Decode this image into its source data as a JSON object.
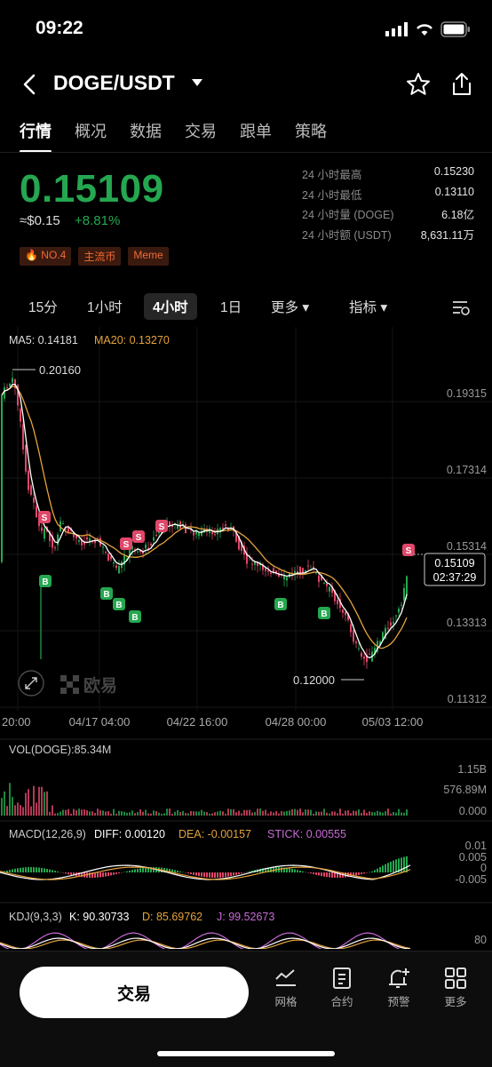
{
  "status": {
    "time": "09:22"
  },
  "header": {
    "pair": "DOGE/USDT"
  },
  "tabs": [
    "行情",
    "概况",
    "数据",
    "交易",
    "跟单",
    "策略"
  ],
  "ticker": {
    "price": "0.15109",
    "usd": "≈$0.15",
    "change": "+8.81%",
    "tags": [
      "NO.4",
      "主流币",
      "Meme"
    ],
    "stats": [
      {
        "label": "24 小时最高",
        "value": "0.15230"
      },
      {
        "label": "24 小时最低",
        "value": "0.13110"
      },
      {
        "label": "24 小时量 (DOGE)",
        "value": "6.18亿"
      },
      {
        "label": "24 小时额 (USDT)",
        "value": "8,631.11万"
      }
    ]
  },
  "intervals": {
    "i15": "15分",
    "i1h": "1小时",
    "i4h": "4小时",
    "i1d": "1日",
    "more": "更多",
    "indicator": "指标"
  },
  "main_chart": {
    "ma5": "MA5: 0.14181",
    "ma20": "MA20: 0.13270",
    "y_ticks": [
      "0.19315",
      "0.17314",
      "0.15314",
      "0.13313",
      "0.11312"
    ],
    "x_ticks": [
      "20:00",
      "04/17 04:00",
      "04/22 16:00",
      "04/28 00:00",
      "05/03 12:00"
    ],
    "high_label": "0.20160",
    "low_label": "0.12000",
    "last_price": "0.15109",
    "countdown": "02:37:29",
    "watermark": "欧易",
    "colors": {
      "up": "#25a750",
      "down": "#e0476a",
      "ma5": "#ffffff",
      "ma20": "#e5a33c"
    }
  },
  "volume": {
    "label": "VOL(DOGE):85.34M",
    "ticks": [
      "1.15B",
      "576.89M",
      "0.000"
    ]
  },
  "macd": {
    "label": "MACD(12,26,9)",
    "diff": "DIFF: 0.00120",
    "dea": "DEA: -0.00157",
    "stick": "STICK: 0.00555",
    "ticks": [
      "0.01",
      "0.005",
      "0",
      "-0.005"
    ]
  },
  "kdj": {
    "label": "KDJ(9,3,3)",
    "k": "K: 90.30733",
    "d": "D: 85.69762",
    "j": "J: 99.52673",
    "tick": "80"
  },
  "bottom": {
    "trade": "交易",
    "items": [
      "网格",
      "合约",
      "预警",
      "更多"
    ]
  }
}
